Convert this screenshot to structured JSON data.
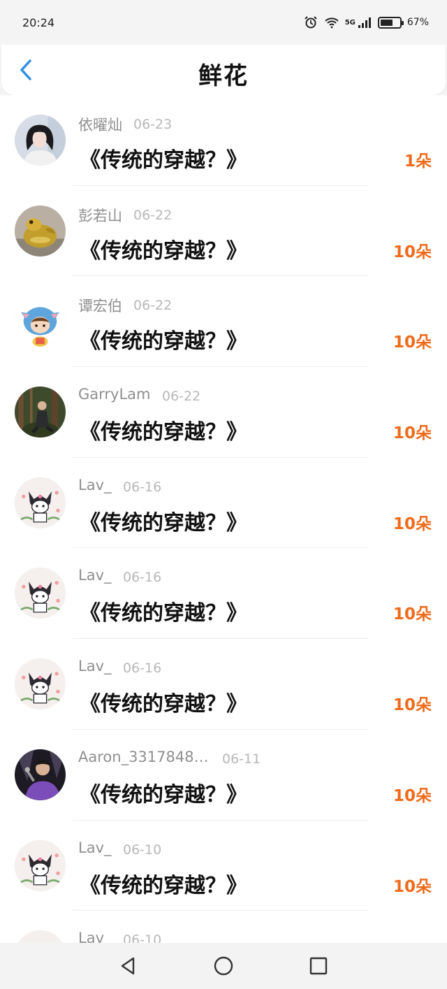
{
  "status": {
    "time": "20:24",
    "battery_percent": 67,
    "battery_label": "67%",
    "signal_label": "5G"
  },
  "header": {
    "title": "鲜花"
  },
  "records": [
    {
      "user": "依曜灿",
      "date": "06-23",
      "title": "《传统的穿越？》",
      "count": "1朵",
      "avatar": "portrait-girl"
    },
    {
      "user": "彭若山",
      "date": "06-22",
      "title": "《传统的穿越？》",
      "count": "10朵",
      "avatar": "golden-frog"
    },
    {
      "user": "谭宏伯",
      "date": "06-22",
      "title": "《传统的穿越？》",
      "count": "10朵",
      "avatar": "stitch-cartoon"
    },
    {
      "user": "GarryLam",
      "date": "06-22",
      "title": "《传统的穿越？》",
      "count": "10朵",
      "avatar": "man-forest"
    },
    {
      "user": "Lav_",
      "date": "06-16",
      "title": "《传统的穿越？》",
      "count": "10朵",
      "avatar": "kuromi"
    },
    {
      "user": "Lav_",
      "date": "06-16",
      "title": "《传统的穿越？》",
      "count": "10朵",
      "avatar": "kuromi"
    },
    {
      "user": "Lav_",
      "date": "06-16",
      "title": "《传统的穿越？》",
      "count": "10朵",
      "avatar": "kuromi"
    },
    {
      "user": "Aaron_33178484…",
      "date": "06-11",
      "title": "《传统的穿越？》",
      "count": "10朵",
      "avatar": "singer"
    },
    {
      "user": "Lav_",
      "date": "06-10",
      "title": "《传统的穿越？》",
      "count": "10朵",
      "avatar": "kuromi"
    },
    {
      "user": "Lav_",
      "date": "06-10",
      "title": "",
      "count": "",
      "avatar": "kuromi"
    }
  ],
  "colors": {
    "accent_blue": "#2f8ee6",
    "count_orange": "#ef6b1b"
  }
}
